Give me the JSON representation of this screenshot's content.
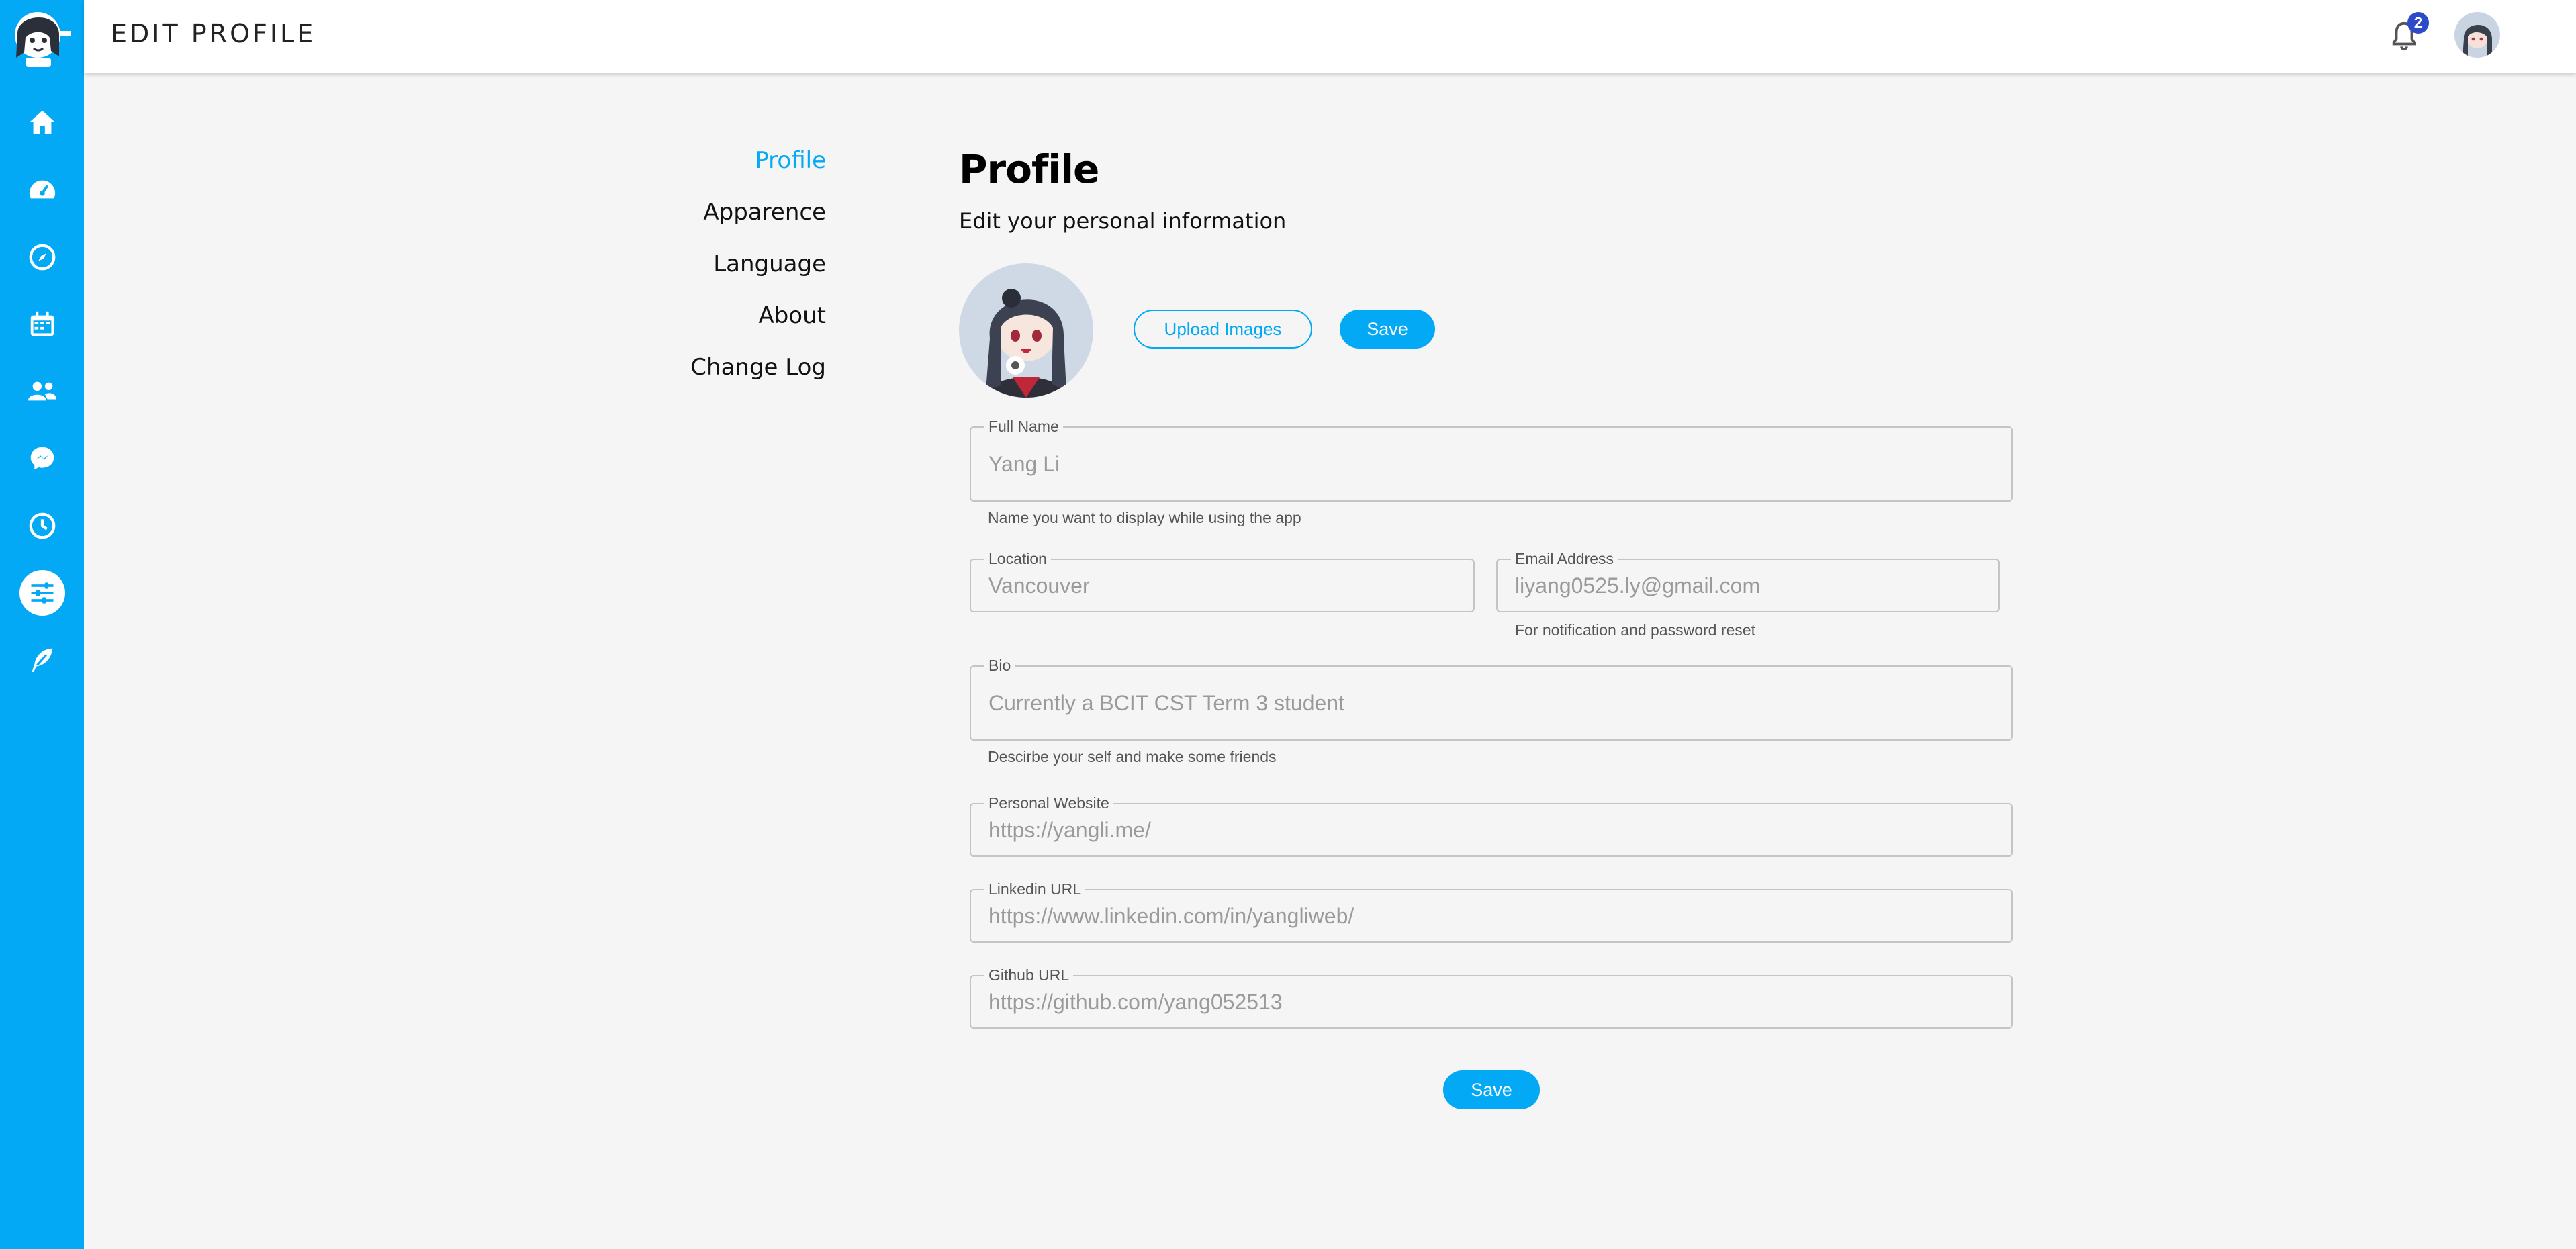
{
  "header": {
    "title": "EDIT PROFILE",
    "notification_count": "2"
  },
  "sidebar": {
    "items": [
      {
        "icon": "home-icon"
      },
      {
        "icon": "dashboard-icon"
      },
      {
        "icon": "compass-icon"
      },
      {
        "icon": "calendar-icon"
      },
      {
        "icon": "users-icon"
      },
      {
        "icon": "messenger-icon"
      },
      {
        "icon": "clock-icon"
      },
      {
        "icon": "settings-sliders-icon",
        "active": true
      },
      {
        "icon": "feather-icon"
      }
    ]
  },
  "settings_menu": {
    "items": [
      "Profile",
      "Apparence",
      "Language",
      "About",
      "Change Log"
    ],
    "active": "Profile"
  },
  "main": {
    "title": "Profile",
    "subtitle": "Edit your personal information",
    "upload_label": "Upload Images",
    "save_label": "Save",
    "fields": {
      "full_name": {
        "label": "Full Name",
        "value": "Yang Li",
        "helper": "Name you want to display while using the app"
      },
      "location": {
        "label": "Location",
        "value": "Vancouver"
      },
      "email": {
        "label": "Email Address",
        "value": "liyang0525.ly@gmail.com",
        "helper": "For notification and password reset"
      },
      "bio": {
        "label": "Bio",
        "value": "Currently a BCIT CST Term 3 student",
        "helper": "Descirbe your self and make some friends"
      },
      "website": {
        "label": "Personal Website",
        "value": "https://yangli.me/"
      },
      "linkedin": {
        "label": "Linkedin URL",
        "value": "https://www.linkedin.com/in/yangliweb/"
      },
      "github": {
        "label": "Github URL",
        "value": "https://github.com/yang052513"
      }
    }
  },
  "colors": {
    "accent": "#03a9f4",
    "badge": "#2d4bc8",
    "background": "#f5f5f5"
  }
}
